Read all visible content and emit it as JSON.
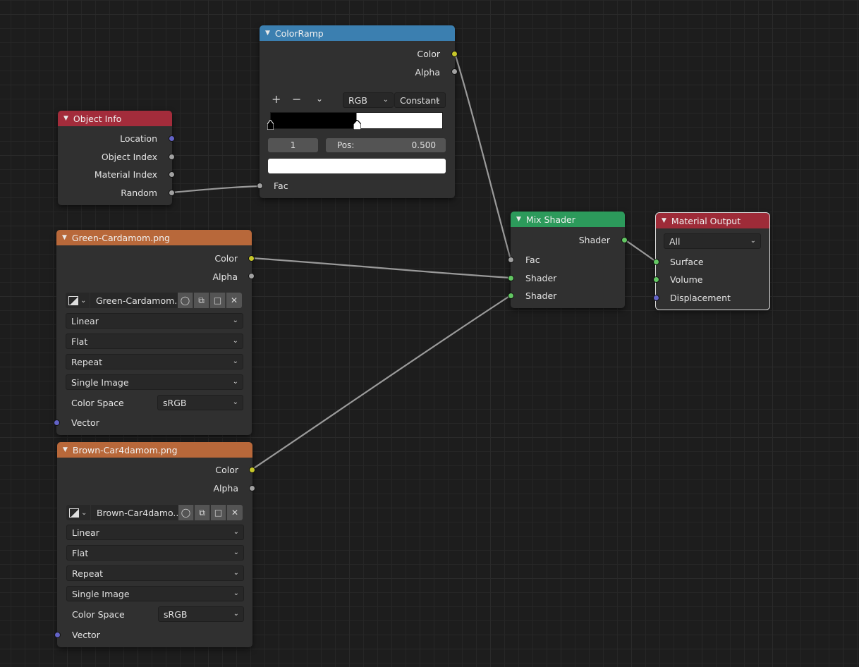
{
  "nodes": {
    "object_info": {
      "title": "Object Info",
      "outputs": [
        "Location",
        "Object Index",
        "Material Index",
        "Random"
      ]
    },
    "color_ramp": {
      "title": "ColorRamp",
      "outputs": [
        "Color",
        "Alpha"
      ],
      "add_symbol": "+",
      "remove_symbol": "−",
      "color_mode": "RGB",
      "interpolation": "Constant",
      "stop_index": "1",
      "pos_label": "Pos:",
      "pos_value": "0.500",
      "stop_color": "#ffffff",
      "input": "Fac"
    },
    "green_texture": {
      "title": "Green-Cardamom.png",
      "outputs": [
        "Color",
        "Alpha"
      ],
      "image_name": "Green-Cardamom...",
      "interpolation": "Linear",
      "projection": "Flat",
      "extension": "Repeat",
      "source": "Single Image",
      "color_space_label": "Color Space",
      "color_space": "sRGB",
      "input": "Vector"
    },
    "brown_texture": {
      "title": "Brown-Car4damom.png",
      "outputs": [
        "Color",
        "Alpha"
      ],
      "image_name": "Brown-Car4damo..",
      "interpolation": "Linear",
      "projection": "Flat",
      "extension": "Repeat",
      "source": "Single Image",
      "color_space_label": "Color Space",
      "color_space": "sRGB",
      "input": "Vector"
    },
    "mix_shader": {
      "title": "Mix Shader",
      "output": "Shader",
      "inputs": [
        "Fac",
        "Shader",
        "Shader"
      ]
    },
    "material_output": {
      "title": "Material Output",
      "target": "All",
      "inputs": [
        "Surface",
        "Volume",
        "Displacement"
      ]
    }
  },
  "colors": {
    "attribute_header": "#a32c3b",
    "converter_header": "#3b7fb0",
    "texture_header": "#b8683a",
    "shader_header": "#2c9a5b",
    "output_header": "#9e2b38",
    "socket_color": "#c7c72a",
    "socket_float": "#a1a1a1",
    "socket_vector": "#6363c7",
    "socket_shader": "#63c763"
  },
  "icons": [
    "collapse-triangle-icon",
    "image-icon",
    "fake-user-shield-icon",
    "duplicate-icon",
    "open-folder-icon",
    "close-icon",
    "chevron-down-icon"
  ]
}
